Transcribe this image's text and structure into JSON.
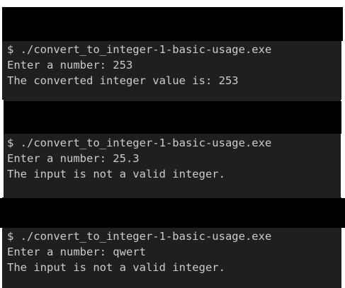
{
  "colors": {
    "terminal_background": "#1f1f1f",
    "terminal_text": "#cccccc",
    "redaction": "#000000"
  },
  "terminals": [
    {
      "lines": [
        "$ ./convert_to_integer-1-basic-usage.exe",
        "Enter a number: 253",
        "The converted integer value is: 253"
      ]
    },
    {
      "lines": [
        "$ ./convert_to_integer-1-basic-usage.exe",
        "Enter a number: 25.3",
        "The input is not a valid integer."
      ]
    },
    {
      "lines": [
        "$ ./convert_to_integer-1-basic-usage.exe",
        "Enter a number: qwert",
        "The input is not a valid integer."
      ]
    }
  ]
}
